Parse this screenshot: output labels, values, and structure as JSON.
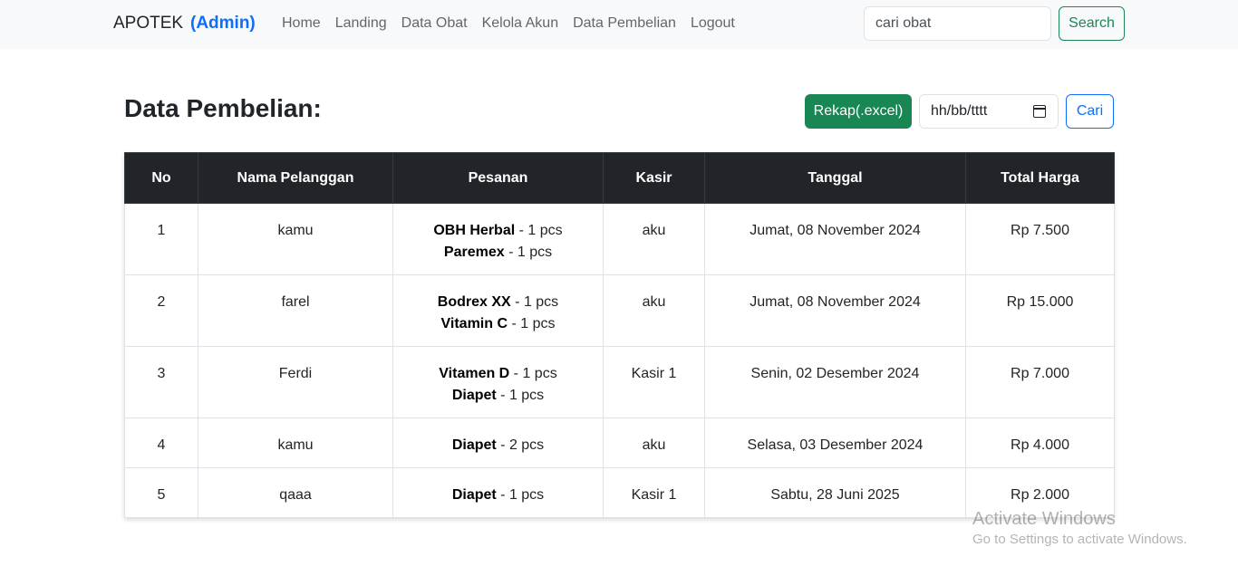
{
  "navbar": {
    "brand": "APOTEK",
    "role": "(Admin)",
    "links": [
      "Home",
      "Landing",
      "Data Obat",
      "Kelola Akun",
      "Data Pembelian",
      "Logout"
    ],
    "search_value": "cari obat",
    "search_button": "Search"
  },
  "page": {
    "title": "Data Pembelian:",
    "rekap_button": "Rekap(.excel)",
    "date_placeholder": "hh/bb/tttt",
    "cari_button": "Cari"
  },
  "table": {
    "headers": [
      "No",
      "Nama Pelanggan",
      "Pesanan",
      "Kasir",
      "Tanggal",
      "Total Harga"
    ],
    "rows": [
      {
        "no": "1",
        "nama": "kamu",
        "items": [
          {
            "name": "OBH Herbal",
            "qty": " - 1 pcs"
          },
          {
            "name": "Paremex",
            "qty": " - 1 pcs"
          }
        ],
        "kasir": "aku",
        "tanggal": "Jumat, 08 November 2024",
        "total": "Rp 7.500"
      },
      {
        "no": "2",
        "nama": "farel",
        "items": [
          {
            "name": "Bodrex XX",
            "qty": " - 1 pcs"
          },
          {
            "name": "Vitamin C",
            "qty": " - 1 pcs"
          }
        ],
        "kasir": "aku",
        "tanggal": "Jumat, 08 November 2024",
        "total": "Rp 15.000"
      },
      {
        "no": "3",
        "nama": "Ferdi",
        "items": [
          {
            "name": "Vitamen D",
            "qty": " - 1 pcs"
          },
          {
            "name": "Diapet",
            "qty": " - 1 pcs"
          }
        ],
        "kasir": "Kasir 1",
        "tanggal": "Senin, 02 Desember 2024",
        "total": "Rp 7.000"
      },
      {
        "no": "4",
        "nama": "kamu",
        "items": [
          {
            "name": "Diapet",
            "qty": " - 2 pcs"
          }
        ],
        "kasir": "aku",
        "tanggal": "Selasa, 03 Desember 2024",
        "total": "Rp 4.000"
      },
      {
        "no": "5",
        "nama": "qaaa",
        "items": [
          {
            "name": "Diapet",
            "qty": " - 1 pcs"
          }
        ],
        "kasir": "Kasir 1",
        "tanggal": "Sabtu, 28 Juni 2025",
        "total": "Rp 2.000"
      }
    ]
  },
  "watermark": {
    "line1": "Activate Windows",
    "line2": "Go to Settings to activate Windows."
  }
}
